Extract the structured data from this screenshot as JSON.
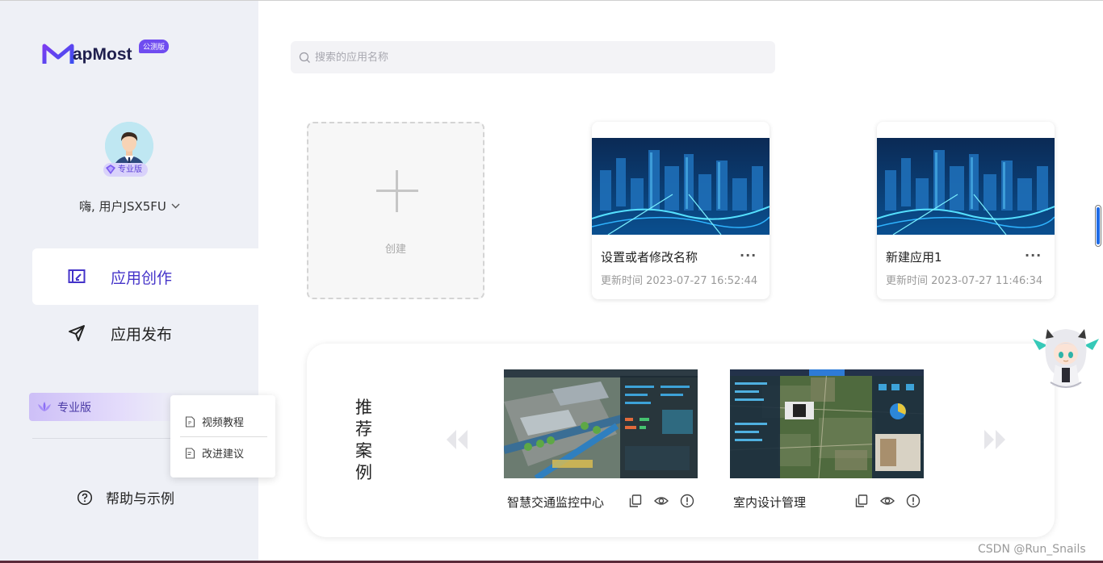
{
  "brand": {
    "logo_text": "apMost",
    "badge": "公测版"
  },
  "user": {
    "tier_badge": "专业版",
    "greeting": "嗨, 用户JSX5FU"
  },
  "nav": [
    {
      "label": "应用创作",
      "active": true
    },
    {
      "label": "应用发布",
      "active": false
    }
  ],
  "pro_banner": {
    "label": "专业版"
  },
  "popup_menu": [
    {
      "label": "视频教程"
    },
    {
      "label": "改进建议"
    }
  ],
  "help": {
    "label": "帮助与示例"
  },
  "search": {
    "placeholder": "搜索的应用名称",
    "value": ""
  },
  "create_card": {
    "label": "创建"
  },
  "apps": [
    {
      "name": "设置或者修改名称",
      "updated": "更新时间 2023-07-27 16:52:44",
      "more": "···"
    },
    {
      "name": "新建应用1",
      "updated": "更新时间 2023-07-27 11:46:34",
      "more": "···"
    }
  ],
  "recommended": {
    "title": "推荐案例",
    "cases": [
      {
        "name": "智慧交通监控中心"
      },
      {
        "name": "室内设计管理"
      }
    ]
  },
  "icons": {
    "search": "search-icon",
    "create": "edit-board-icon",
    "publish": "send-icon",
    "help": "question-circle-icon",
    "copy": "copy-icon",
    "preview": "eye-icon",
    "info": "info-icon"
  },
  "colors": {
    "accent": "#4433c9",
    "badge": "#6f4cf0",
    "sidebar_bg": "#eef0f6",
    "scrollbar": "#1e6be6"
  },
  "watermark": "CSDN @Run_Snails"
}
